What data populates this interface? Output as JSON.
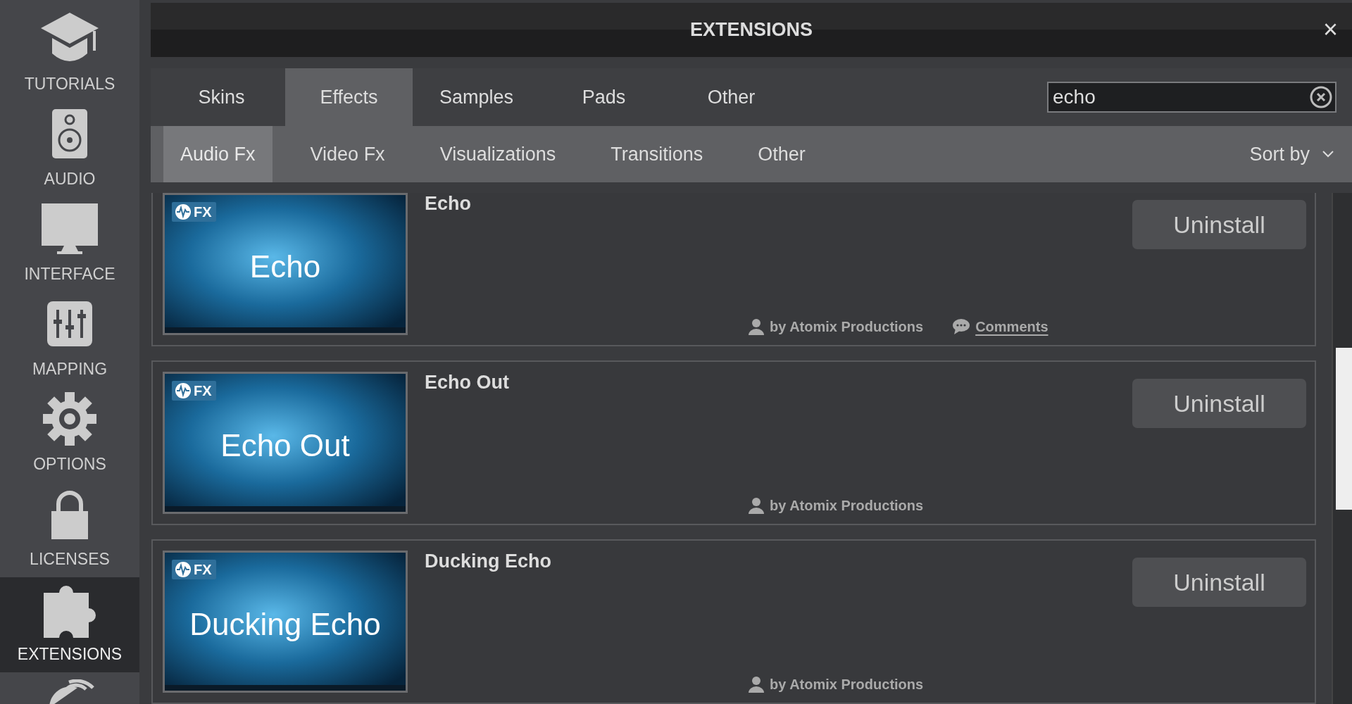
{
  "sidebar": {
    "items": [
      {
        "label": "TUTORIALS",
        "selected": false
      },
      {
        "label": "AUDIO",
        "selected": false
      },
      {
        "label": "INTERFACE",
        "selected": false
      },
      {
        "label": "MAPPING",
        "selected": false
      },
      {
        "label": "OPTIONS",
        "selected": false
      },
      {
        "label": "LICENSES",
        "selected": false
      },
      {
        "label": "EXTENSIONS",
        "selected": true
      }
    ]
  },
  "window": {
    "title": "EXTENSIONS",
    "close": "×"
  },
  "tabs": [
    {
      "label": "Skins",
      "selected": false
    },
    {
      "label": "Effects",
      "selected": true
    },
    {
      "label": "Samples",
      "selected": false
    },
    {
      "label": "Pads",
      "selected": false
    },
    {
      "label": "Other",
      "selected": false
    }
  ],
  "search": {
    "value": "echo"
  },
  "subtabs": [
    {
      "label": "Audio Fx",
      "selected": true
    },
    {
      "label": "Video Fx",
      "selected": false
    },
    {
      "label": "Visualizations",
      "selected": false
    },
    {
      "label": "Transitions",
      "selected": false
    },
    {
      "label": "Other",
      "selected": false
    }
  ],
  "sort": {
    "label": "Sort by"
  },
  "extensions": [
    {
      "name": "Echo",
      "badge": "FX",
      "thumbnail_label": "Echo",
      "author": "by Atomix Productions",
      "comments": "Comments",
      "button": "Uninstall"
    },
    {
      "name": "Echo Out",
      "badge": "FX",
      "thumbnail_label": "Echo Out",
      "author": "by Atomix Productions",
      "button": "Uninstall"
    },
    {
      "name": "Ducking Echo",
      "badge": "FX",
      "thumbnail_label": "Ducking Echo",
      "author": "by Atomix Productions",
      "button": "Uninstall"
    }
  ]
}
